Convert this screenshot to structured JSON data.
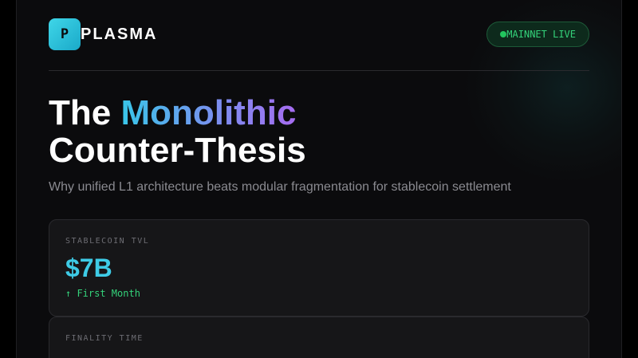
{
  "header": {
    "logo_letter": "P",
    "brand": "PLASMA",
    "status_badge": "MAINNET LIVE"
  },
  "hero": {
    "title_line1_prefix": "The ",
    "title_line1_accent": "Monolithic",
    "title_line2": "Counter-Thesis",
    "subtitle": "Why unified L1 architecture beats modular fragmentation for stablecoin settlement"
  },
  "metrics": [
    {
      "label": "STABLECOIN TVL",
      "value": "$7B",
      "change": "↑ First Month"
    },
    {
      "label": "FINALITY TIME"
    }
  ],
  "colors": {
    "accent_cyan": "#3ecbe6",
    "live_green": "#34d27a",
    "gradient_start": "#38c6e8",
    "gradient_end": "#a66cf0",
    "background": "#0b0b0d"
  },
  "icons": {
    "status_dot": "live-dot-icon"
  }
}
